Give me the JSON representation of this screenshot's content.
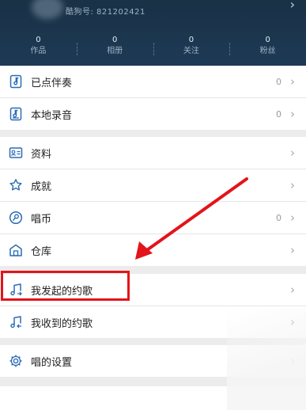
{
  "header": {
    "id_text": "酷狗号: 821202421",
    "stats": [
      {
        "value": "0",
        "label": "作品"
      },
      {
        "value": "0",
        "label": "相册"
      },
      {
        "value": "0",
        "label": "关注"
      },
      {
        "value": "0",
        "label": "粉丝"
      }
    ]
  },
  "group1": {
    "items": [
      {
        "label": "已点伴奏",
        "count": "0",
        "icon": "music-note-doc-icon"
      },
      {
        "label": "本地录音",
        "count": "0",
        "icon": "local-recording-icon"
      }
    ]
  },
  "group2": {
    "items": [
      {
        "label": "资料",
        "icon": "profile-card-icon"
      },
      {
        "label": "成就",
        "icon": "achievement-star-icon"
      },
      {
        "label": "唱币",
        "count": "0",
        "icon": "coin-icon"
      },
      {
        "label": "仓库",
        "icon": "warehouse-icon"
      }
    ]
  },
  "group3": {
    "items": [
      {
        "label": "我发起的约歌",
        "icon": "music-note-out-icon"
      },
      {
        "label": "我收到的约歌",
        "icon": "music-note-in-icon"
      }
    ]
  },
  "group4": {
    "items": [
      {
        "label": "唱的设置",
        "icon": "gear-icon"
      }
    ]
  },
  "colors": {
    "header_bg": "#1d3a56",
    "accent_blue": "#2b6cb5",
    "annotation_red": "#e3141a"
  }
}
